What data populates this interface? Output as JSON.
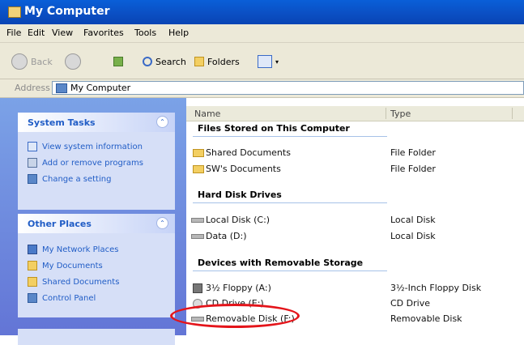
{
  "window": {
    "title": "My Computer"
  },
  "menu": [
    "File",
    "Edit",
    "View",
    "Favorites",
    "Tools",
    "Help"
  ],
  "toolbar": {
    "back_label": "Back",
    "search_label": "Search",
    "folders_label": "Folders"
  },
  "address": {
    "label": "Address",
    "value": "My Computer"
  },
  "sidebar": {
    "system_tasks": {
      "title": "System Tasks",
      "items": [
        {
          "label": "View system information",
          "icon": "info-icon"
        },
        {
          "label": "Add or remove programs",
          "icon": "programs-icon"
        },
        {
          "label": "Change a setting",
          "icon": "control-panel-icon"
        }
      ]
    },
    "other_places": {
      "title": "Other Places",
      "items": [
        {
          "label": "My Network Places",
          "icon": "network-icon"
        },
        {
          "label": "My Documents",
          "icon": "folder-icon"
        },
        {
          "label": "Shared Documents",
          "icon": "folder-icon"
        },
        {
          "label": "Control Panel",
          "icon": "control-panel-icon"
        }
      ]
    }
  },
  "columns": {
    "name": "Name",
    "type": "Type"
  },
  "groups": [
    {
      "title": "Files Stored on This Computer",
      "items": [
        {
          "name": "Shared Documents",
          "type": "File Folder",
          "icon": "folder-icon"
        },
        {
          "name": "SW's Documents",
          "type": "File Folder",
          "icon": "folder-icon"
        }
      ]
    },
    {
      "title": "Hard Disk Drives",
      "items": [
        {
          "name": "Local Disk (C:)",
          "type": "Local Disk",
          "icon": "drive-icon"
        },
        {
          "name": "Data (D:)",
          "type": "Local Disk",
          "icon": "drive-icon"
        }
      ]
    },
    {
      "title": "Devices with Removable Storage",
      "items": [
        {
          "name": "3½ Floppy (A:)",
          "type": "3½-Inch Floppy Disk",
          "icon": "floppy-icon"
        },
        {
          "name": "CD Drive (E:)",
          "type": "CD Drive",
          "icon": "cd-icon"
        },
        {
          "name": "Removable Disk (F:)",
          "type": "Removable Disk",
          "icon": "drive-icon"
        }
      ]
    }
  ],
  "colors": {
    "titlebar": "#0b4ec2",
    "sidebar": "#6f88dd",
    "highlight_ring": "#e4141a"
  }
}
